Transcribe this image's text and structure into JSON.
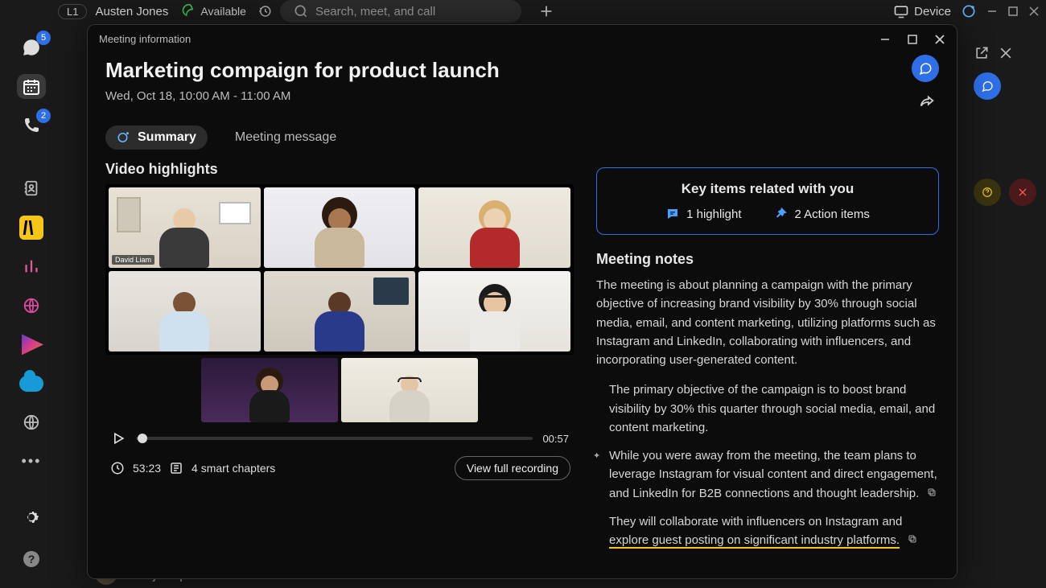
{
  "topbar": {
    "line_tag": "L1",
    "user_name": "Austen Jones",
    "status_label": "Available",
    "search_placeholder": "Search, meet, and call",
    "device_label": "Device"
  },
  "left_rail": {
    "chat_badge": "5",
    "phone_badge": "2"
  },
  "panel": {
    "window_title": "Meeting information",
    "title": "Marketing compaign for product launch",
    "subtitle": "Wed, Oct 18, 10:00 AM - 11:00 AM",
    "tabs": {
      "summary": "Summary",
      "message": "Meeting message"
    },
    "video": {
      "heading": "Video highlights",
      "name_tag": "David Liam",
      "current_time": "00:57",
      "duration": "53:23",
      "chapters": "4 smart chapters",
      "full_btn": "View full recording"
    },
    "key_card": {
      "title": "Key items related with you",
      "highlight": "1 highlight",
      "actions": "2 Action items"
    },
    "notes": {
      "heading": "Meeting notes",
      "para": "The meeting is about planning a campaign with the primary objective of increasing brand visibility by 30% through social media, email, and content marketing, utilizing platforms such as Instagram and LinkedIn, collaborating with influencers, and incorporating user-generated content.",
      "item1": "The primary objective of the campaign is to boost brand visibility by 30% this quarter through social media, email, and content marketing.",
      "item2": "While you were away from the meeting, the team plans to leverage Instagram for visual content and direct engagement, and LinkedIn for B2B connections and thought leadership.",
      "item3a": "They will collaborate with influencers on Instagram and ",
      "item3b": "explore guest posting on significant industry platforms."
    }
  },
  "bottom_peek": "Project plan review"
}
